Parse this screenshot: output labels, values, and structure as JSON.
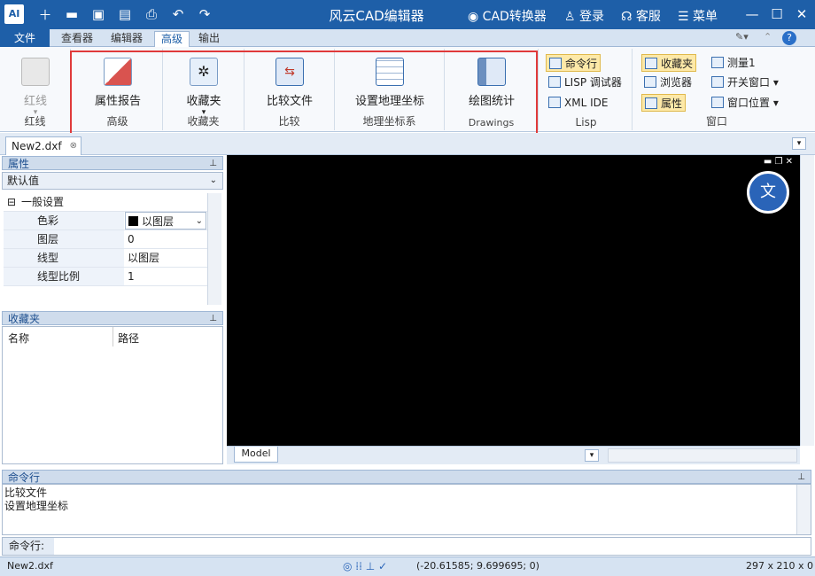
{
  "titlebar": {
    "app_icon": "AI",
    "title": "风云CAD编辑器",
    "converter": "CAD转换器",
    "login": "登录",
    "service": "客服",
    "menu": "菜单"
  },
  "tabs": {
    "file": "文件",
    "viewer": "查看器",
    "editor": "编辑器",
    "advanced": "高级",
    "output": "输出"
  },
  "ribbon": {
    "redline": {
      "button": "红线",
      "group": "红线"
    },
    "advanced": {
      "button": "属性报告",
      "group": "高级"
    },
    "favorites": {
      "button": "收藏夹",
      "group": "收藏夹"
    },
    "compare": {
      "button": "比较文件",
      "group": "比较"
    },
    "geo": {
      "button": "设置地理坐标",
      "group": "地理坐标系"
    },
    "drawings": {
      "button": "绘图统计",
      "group": "Drawings"
    },
    "lisp": {
      "cmdline": "命令行",
      "debugger": "LISP 调试器",
      "xmlide": "XML IDE",
      "group": "Lisp"
    },
    "window": {
      "favorites": "收藏夹",
      "browser": "浏览器",
      "properties": "属性",
      "measure": "测量1",
      "switch": "开关窗口",
      "position": "窗口位置",
      "group": "窗口"
    }
  },
  "doc_tab": "New2.dxf",
  "properties_panel": {
    "title": "属性",
    "selector": "默认值",
    "section": "一般设置",
    "rows": [
      {
        "name": "色彩",
        "value": "以图层"
      },
      {
        "name": "图层",
        "value": "0"
      },
      {
        "name": "线型",
        "value": "以图层"
      },
      {
        "name": "线型比例",
        "value": "1"
      }
    ]
  },
  "favorites_panel": {
    "title": "收藏夹",
    "col_name": "名称",
    "col_path": "路径"
  },
  "canvas": {
    "model_tab": "Model"
  },
  "command_panel": {
    "title": "命令行",
    "lines": [
      "比较文件",
      "设置地理坐标"
    ],
    "prompt": "命令行:"
  },
  "statusbar": {
    "file": "New2.dxf",
    "coords": "(-20.61585; 9.699695; 0)",
    "size": "297 x 210 x 0"
  },
  "colors": {
    "titlebar": "#1e5fa8",
    "highlight": "#e03a3a",
    "canvas": "#000000"
  }
}
